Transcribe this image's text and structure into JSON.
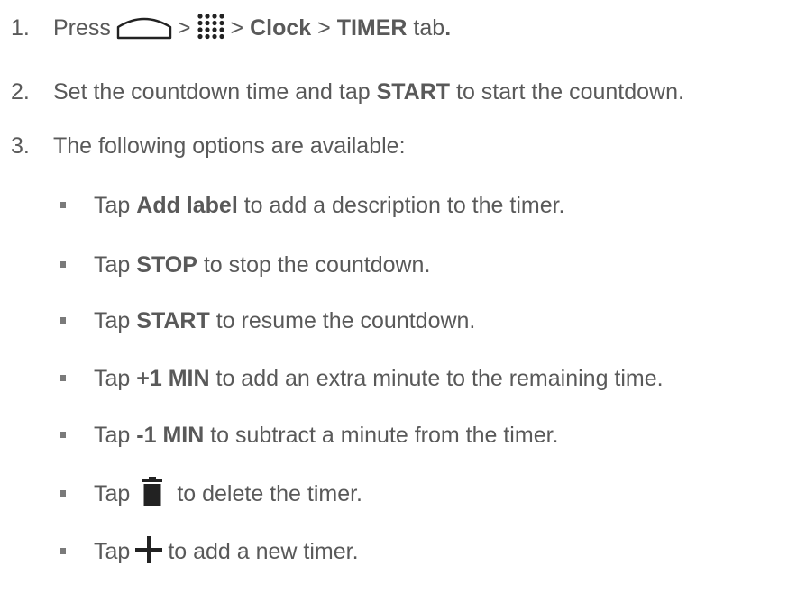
{
  "steps": [
    {
      "number": "1.",
      "parts": {
        "press": "Press",
        "sep1": ">",
        "sep2": ">",
        "clock": "Clock",
        "sep3": ">",
        "timer_tab": "TIMER",
        "tab_word": "tab",
        "period": "."
      },
      "icons": [
        "home-icon",
        "apps-grid-icon"
      ]
    },
    {
      "number": "2.",
      "parts": {
        "pre": "Set the countdown time and tap",
        "start": "START",
        "post": "to start the countdown."
      }
    },
    {
      "number": "3.",
      "parts": {
        "text": "The following options are available:"
      }
    }
  ],
  "options": [
    {
      "tap": "Tap",
      "bold": "Add label",
      "rest": "to add a description to the timer."
    },
    {
      "tap": "Tap",
      "bold": "STOP",
      "rest": "to stop the countdown."
    },
    {
      "tap": "Tap",
      "bold": "START",
      "rest": "to resume the countdown."
    },
    {
      "tap": "Tap",
      "bold": "+1 MIN",
      "rest": "to add an extra minute to the remaining time."
    },
    {
      "tap": "Tap",
      "bold": "-1 MIN",
      "rest": "to subtract a minute from the timer."
    },
    {
      "tap": "Tap",
      "icon": "trash-icon",
      "rest": "to delete the timer."
    },
    {
      "tap": "Tap",
      "icon": "plus-icon",
      "rest": "to add a new timer."
    }
  ],
  "colors": {
    "text": "#595959",
    "icon": "#222222",
    "bullet": "#7a7a7a"
  }
}
